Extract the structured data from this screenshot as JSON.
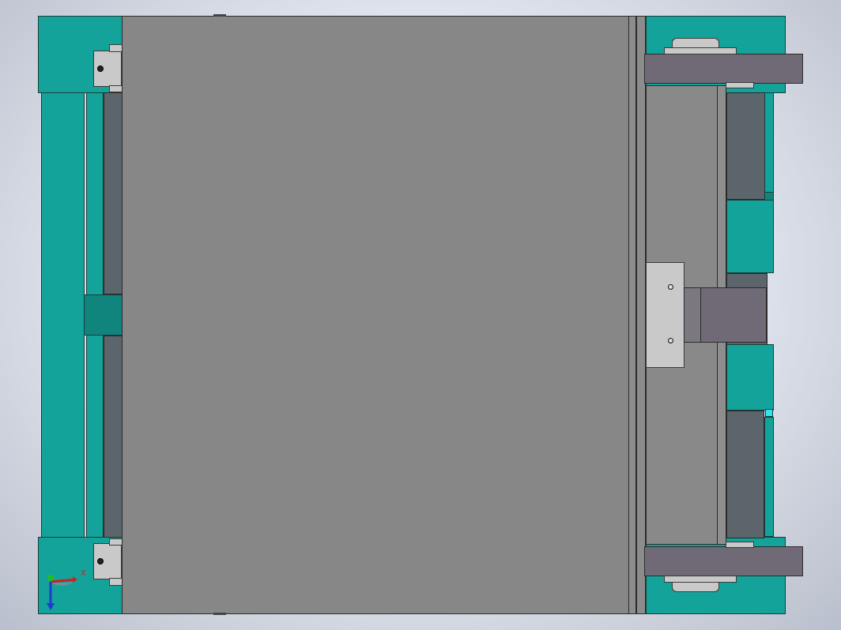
{
  "viewport": {
    "background": "#dfe3ec",
    "model_colors": {
      "frame": "#13a39a",
      "plate": "#878787",
      "bracket": "#6f6a75"
    }
  },
  "triad": {
    "x_label": "X",
    "x_color": "#d21e1e",
    "y_color": "#1ec21e",
    "z_color": "#1e3ad2"
  }
}
